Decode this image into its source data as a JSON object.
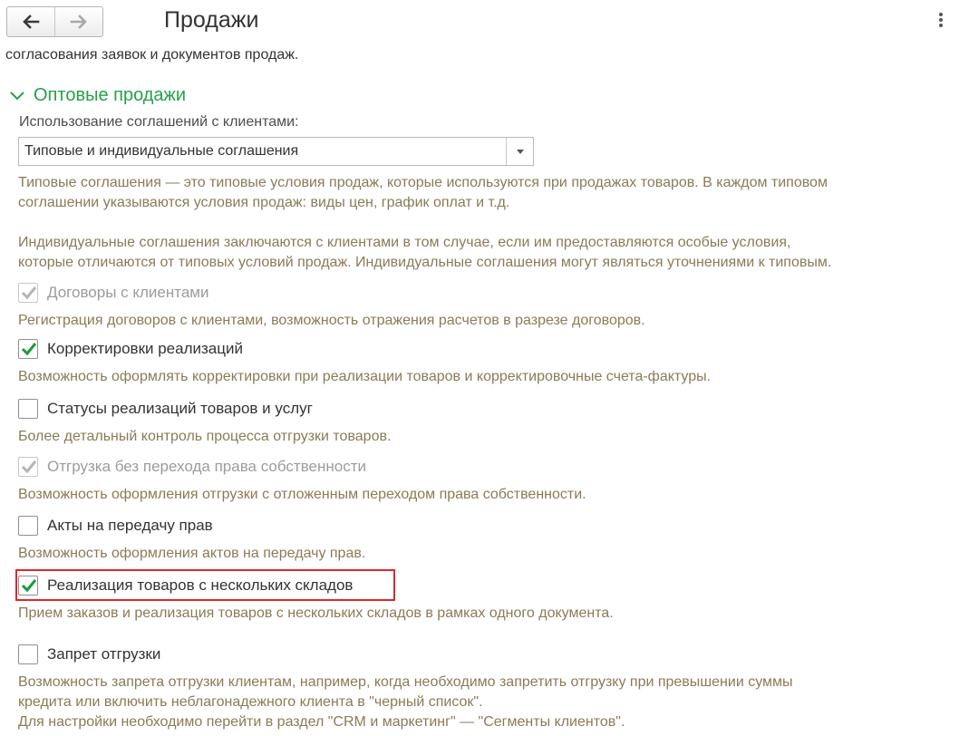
{
  "header": {
    "title": "Продажи",
    "back_icon": "arrow-left-icon",
    "forward_icon": "arrow-right-icon",
    "more_icon": "more-vertical-icon"
  },
  "intro_text": "согласования заявок и документов продаж.",
  "group": {
    "title": "Оптовые продажи",
    "accent_color": "#24a148"
  },
  "agreements": {
    "label": "Использование соглашений с клиентами:",
    "value": "Типовые и индивидуальные соглашения",
    "desc_1": [
      "Типовые соглашения — это типовые условия продаж, которые используются при продажах товаров. В каждом типовом",
      "соглашении указываются условия продаж: виды цен, график оплат и т.д."
    ],
    "desc_2": [
      "Индивидуальные соглашения заключаются с клиентами в том случае, если им предоставляются особые условия,",
      "которые отличаются от типовых условий продаж. Индивидуальные соглашения могут являться уточнениями к типовым."
    ]
  },
  "options": [
    {
      "label": "Договоры с клиентами",
      "checked": true,
      "disabled": true,
      "desc": [
        "Регистрация договоров с клиентами, возможность отражения расчетов в разрезе договоров."
      ]
    },
    {
      "label": "Корректировки реализаций",
      "checked": true,
      "disabled": false,
      "desc": [
        "Возможность оформлять корректировки при реализации товаров и корректировочные счета-фактуры."
      ]
    },
    {
      "label": "Статусы реализаций товаров и услуг",
      "checked": false,
      "disabled": false,
      "desc": [
        "Более детальный контроль процесса отгрузки товаров."
      ]
    },
    {
      "label": "Отгрузка без перехода права собственности",
      "checked": true,
      "disabled": true,
      "desc": [
        "Возможность оформления отгрузки с отложенным переходом права собственности."
      ]
    },
    {
      "label": "Акты на передачу прав",
      "checked": false,
      "disabled": false,
      "desc": [
        "Возможность оформления актов на передачу прав."
      ]
    },
    {
      "label": "Реализация товаров с нескольких складов",
      "checked": true,
      "disabled": false,
      "highlighted": true,
      "desc": [
        "Прием заказов и реализация товаров с нескольких складов в рамках одного документа."
      ]
    },
    {
      "label": "Запрет отгрузки",
      "checked": false,
      "disabled": false,
      "desc": [
        "Возможность запрета отгрузки клиентам, например, когда необходимо запретить отгрузку при превышении суммы",
        "кредита или включить неблагонадежного клиента в \"черный список\".",
        "Для настройки необходимо перейти в раздел \"CRM и маркетинг\" — \"Сегменты клиентов\"."
      ]
    }
  ],
  "colors": {
    "check_green": "#1a9a3a",
    "check_disabled": "#b4b4b4",
    "description_text": "#8a7b57",
    "highlight_border": "#e0262b"
  }
}
